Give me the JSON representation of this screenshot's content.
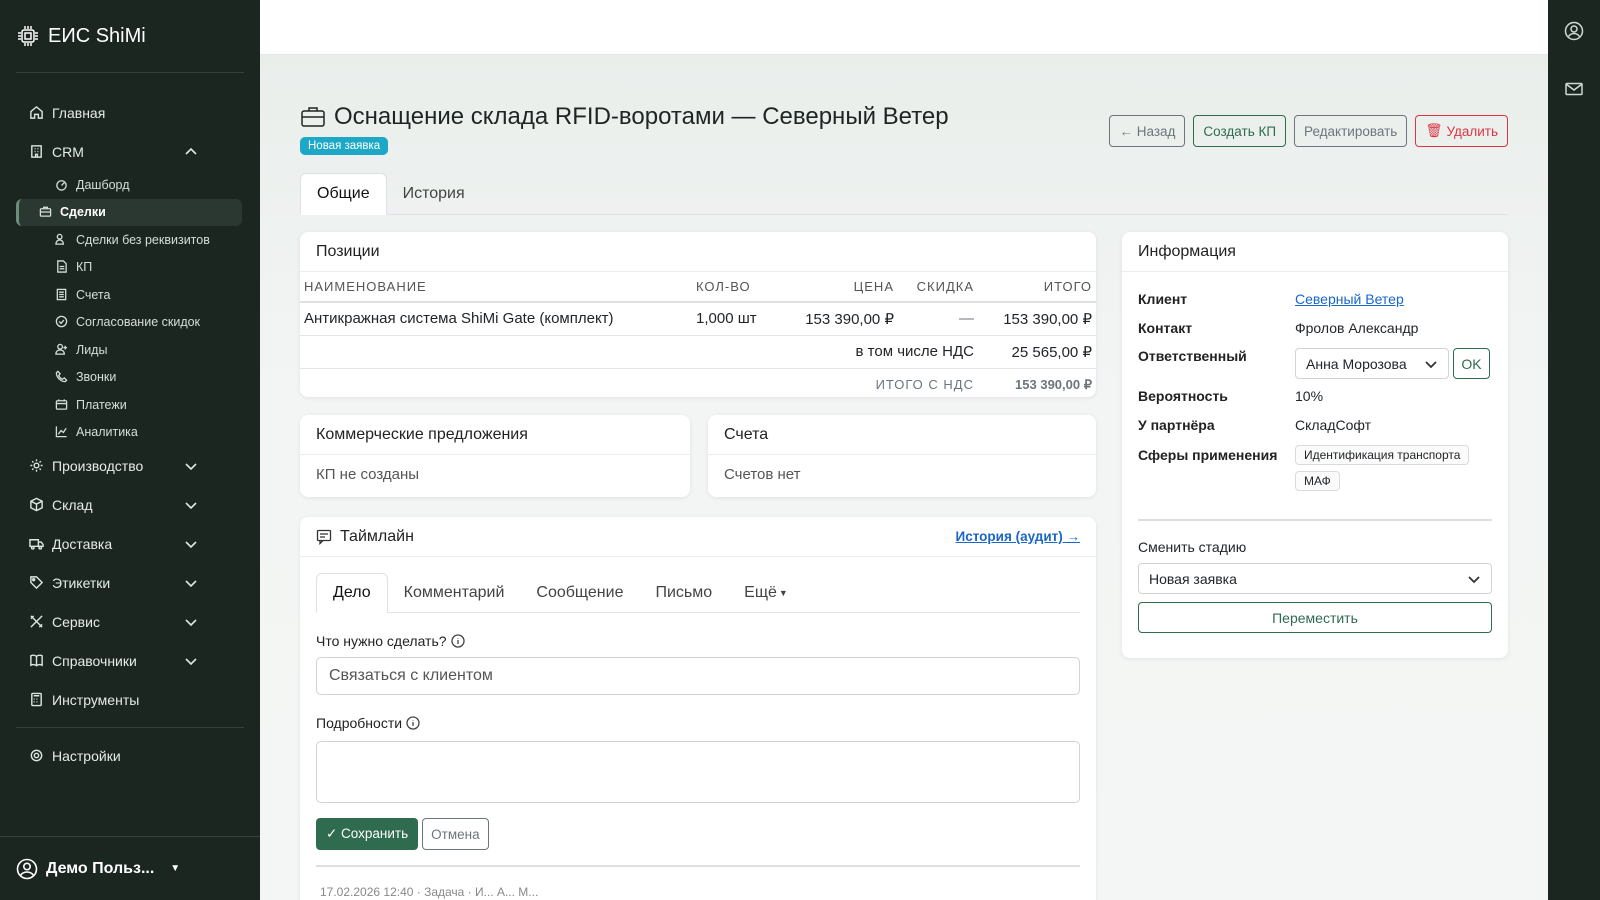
{
  "app": {
    "brand": "ЕИС ShiMi"
  },
  "sidebar": {
    "items": [
      {
        "label": "Главная",
        "icon": "home-icon"
      },
      {
        "label": "CRM",
        "icon": "building-icon"
      },
      {
        "label": "Производство",
        "icon": "gear-icon"
      },
      {
        "label": "Склад",
        "icon": "box-icon"
      },
      {
        "label": "Доставка",
        "icon": "truck-icon"
      },
      {
        "label": "Этикетки",
        "icon": "tag-icon"
      },
      {
        "label": "Сервис",
        "icon": "tools-icon"
      },
      {
        "label": "Справочники",
        "icon": "book-icon"
      },
      {
        "label": "Инструменты",
        "icon": "calculator-icon"
      },
      {
        "label": "Настройки",
        "icon": "settings-icon"
      }
    ],
    "crm_sub": [
      {
        "label": "Дашборд",
        "icon": "speedometer-icon"
      },
      {
        "label": "Сделки",
        "icon": "briefcase-icon"
      },
      {
        "label": "Сделки без реквизитов",
        "icon": "person-lines-icon"
      },
      {
        "label": "КП",
        "icon": "file-text-icon"
      },
      {
        "label": "Счета",
        "icon": "receipt-icon"
      },
      {
        "label": "Согласование скидок",
        "icon": "check-circle-icon"
      },
      {
        "label": "Лиды",
        "icon": "person-plus-icon"
      },
      {
        "label": "Звонки",
        "icon": "phone-icon"
      },
      {
        "label": "Платежи",
        "icon": "wallet-icon"
      },
      {
        "label": "Аналитика",
        "icon": "graph-icon"
      }
    ],
    "user": "Демо Польз..."
  },
  "page": {
    "title": "Оснащение склада RFID-воротами — Северный Ветер",
    "status_badge": "Новая заявка",
    "actions": {
      "back": "← Назад",
      "create_kp": "Создать КП",
      "edit": "Редактировать",
      "delete": "Удалить"
    },
    "tabs": [
      "Общие",
      "История"
    ]
  },
  "positions": {
    "title": "Позиции",
    "headers": [
      "НАИМЕНОВАНИЕ",
      "КОЛ-ВО",
      "ЦЕНА",
      "СКИДКА",
      "ИТОГО"
    ],
    "rows": [
      [
        "Антикражная система ShiMi Gate (комплект)",
        "1,000 шт",
        "153 390,00 ₽",
        "—",
        "153 390,00 ₽"
      ]
    ],
    "vat_label": "в том числе НДС",
    "vat_value": "25 565,00 ₽",
    "total_label": "ИТОГО С НДС",
    "total_value": "153 390,00 ₽"
  },
  "kp": {
    "title": "Коммерческие предложения",
    "empty": "КП не созданы"
  },
  "invoices": {
    "title": "Счета",
    "empty": "Счетов нет"
  },
  "timeline": {
    "title": "Таймлайн",
    "audit_link": "История (аудит) →",
    "tabs": [
      "Дело",
      "Комментарий",
      "Сообщение",
      "Письмо",
      "Ещё"
    ],
    "todo_label": "Что нужно сделать?",
    "todo_value": "Связаться с клиентом",
    "details_label": "Подробности",
    "details_value": "",
    "save": "✓ Сохранить",
    "cancel": "Отмена",
    "next_entry_partial": "17.02.2026 12:40 · Задача · И... А... М..."
  },
  "info": {
    "title": "Информация",
    "client_label": "Клиент",
    "client": "Северный Ветер",
    "contact_label": "Контакт",
    "contact": "Фролов Александр",
    "responsible_label": "Ответственный",
    "responsible": "Анна Морозова",
    "ok": "OK",
    "probability_label": "Вероятность",
    "probability": "10%",
    "partner_label": "У партнёра",
    "partner": "СкладСофт",
    "spheres_label": "Сферы применения",
    "spheres": [
      "Идентификация транспорта",
      "МАФ"
    ],
    "stage_label": "Сменить стадию",
    "stage_value": "Новая заявка",
    "move": "Переместить"
  },
  "colors": {
    "sidebar": "#1b2621",
    "accent": "#2f6b4f",
    "badge": "#1ea8c8",
    "danger": "#dc3545"
  }
}
